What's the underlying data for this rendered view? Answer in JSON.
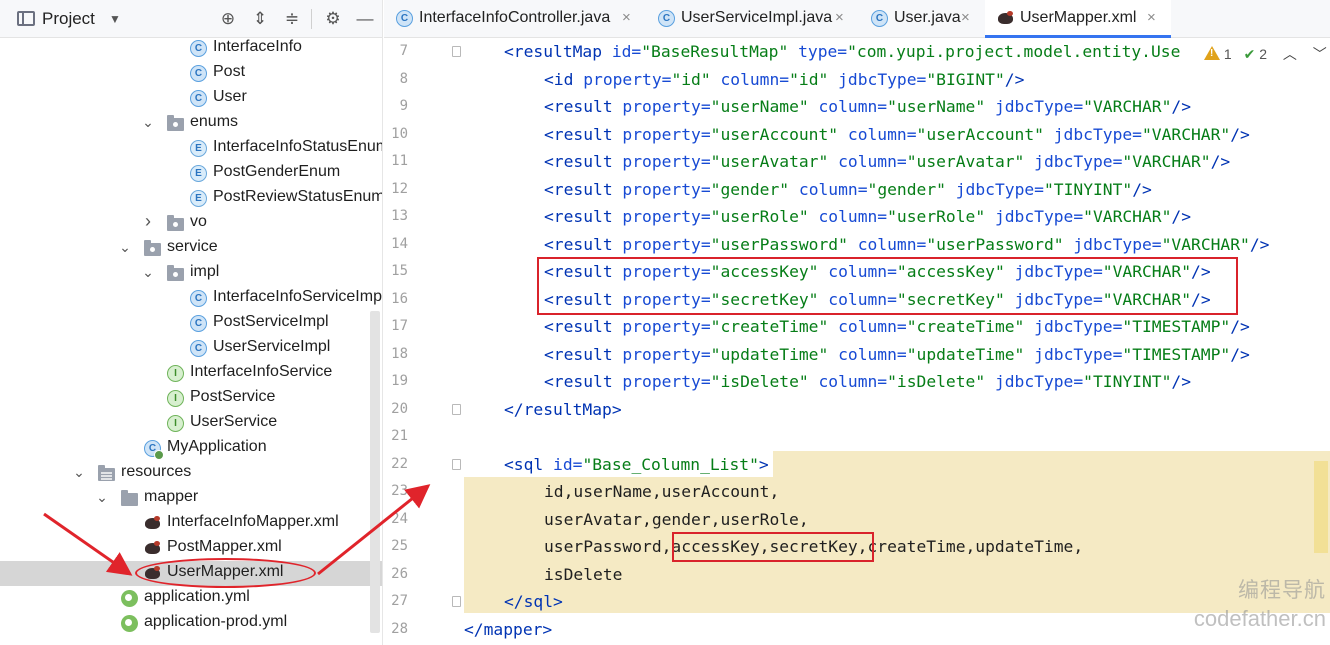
{
  "project_panel": {
    "title": "Project",
    "tools": [
      "target-icon",
      "expand-all-icon",
      "collapse-all-icon",
      "gear-icon",
      "minimize-icon"
    ],
    "tree": [
      {
        "label": "InterfaceInfo",
        "icon": "class",
        "depth": 5
      },
      {
        "label": "Post",
        "icon": "class",
        "depth": 5
      },
      {
        "label": "User",
        "icon": "class",
        "depth": 5
      },
      {
        "label": "enums",
        "icon": "package",
        "depth": 4,
        "expanded": true
      },
      {
        "label": "InterfaceInfoStatusEnum",
        "icon": "enum",
        "depth": 5
      },
      {
        "label": "PostGenderEnum",
        "icon": "enum",
        "depth": 5
      },
      {
        "label": "PostReviewStatusEnum",
        "icon": "enum",
        "depth": 5
      },
      {
        "label": "vo",
        "icon": "package",
        "depth": 4,
        "expanded": false
      },
      {
        "label": "service",
        "icon": "package",
        "depth": 3,
        "expanded": true
      },
      {
        "label": "impl",
        "icon": "package",
        "depth": 4,
        "expanded": true
      },
      {
        "label": "InterfaceInfoServiceImpl",
        "icon": "class",
        "depth": 5
      },
      {
        "label": "PostServiceImpl",
        "icon": "class",
        "depth": 5
      },
      {
        "label": "UserServiceImpl",
        "icon": "class",
        "depth": 5
      },
      {
        "label": "InterfaceInfoService",
        "icon": "interface",
        "depth": 4
      },
      {
        "label": "PostService",
        "icon": "interface",
        "depth": 4
      },
      {
        "label": "UserService",
        "icon": "interface",
        "depth": 4
      },
      {
        "label": "MyApplication",
        "icon": "app",
        "depth": 3
      },
      {
        "label": "resources",
        "icon": "resources",
        "depth": 1,
        "expanded": true
      },
      {
        "label": "mapper",
        "icon": "folder",
        "depth": 2,
        "expanded": true
      },
      {
        "label": "InterfaceInfoMapper.xml",
        "icon": "mybatis",
        "depth": 3
      },
      {
        "label": "PostMapper.xml",
        "icon": "mybatis",
        "depth": 3
      },
      {
        "label": "UserMapper.xml",
        "icon": "mybatis",
        "depth": 3,
        "selected": true
      },
      {
        "label": "application.yml",
        "icon": "yml",
        "depth": 2
      },
      {
        "label": "application-prod.yml",
        "icon": "yml",
        "depth": 2
      }
    ]
  },
  "tabs": [
    {
      "label": "InterfaceInfoController.java",
      "icon": "class",
      "active": false
    },
    {
      "label": "UserServiceImpl.java",
      "icon": "class",
      "active": false
    },
    {
      "label": "User.java",
      "icon": "class",
      "active": false
    },
    {
      "label": "UserMapper.xml",
      "icon": "mybatis",
      "active": true
    }
  ],
  "inspection": {
    "warnings": "1",
    "checks": "2"
  },
  "editor": {
    "lines": [
      {
        "n": "7",
        "tokens": [
          [
            "t",
            "<resultMap "
          ],
          [
            "a",
            "id="
          ],
          [
            "v",
            "\"BaseResultMap\" "
          ],
          [
            "a",
            "type="
          ],
          [
            "v",
            "\"com.yupi.project.model.entity.Use"
          ]
        ]
      },
      {
        "n": "8",
        "tokens": [
          [
            "t",
            "<id "
          ],
          [
            "a",
            "property="
          ],
          [
            "v",
            "\"id\" "
          ],
          [
            "a",
            "column="
          ],
          [
            "v",
            "\"id\" "
          ],
          [
            "a",
            "jdbcType="
          ],
          [
            "v",
            "\"BIGINT\""
          ],
          [
            "t",
            "/>"
          ]
        ]
      },
      {
        "n": "9",
        "tokens": [
          [
            "t",
            "<result "
          ],
          [
            "a",
            "property="
          ],
          [
            "v",
            "\"userName\" "
          ],
          [
            "a",
            "column="
          ],
          [
            "v",
            "\"userName\" "
          ],
          [
            "a",
            "jdbcType="
          ],
          [
            "v",
            "\"VARCHAR\""
          ],
          [
            "t",
            "/>"
          ]
        ]
      },
      {
        "n": "10",
        "tokens": [
          [
            "t",
            "<result "
          ],
          [
            "a",
            "property="
          ],
          [
            "v",
            "\"userAccount\" "
          ],
          [
            "a",
            "column="
          ],
          [
            "v",
            "\"userAccount\" "
          ],
          [
            "a",
            "jdbcType="
          ],
          [
            "v",
            "\"VARCHAR\""
          ],
          [
            "t",
            "/>"
          ]
        ]
      },
      {
        "n": "11",
        "tokens": [
          [
            "t",
            "<result "
          ],
          [
            "a",
            "property="
          ],
          [
            "v",
            "\"userAvatar\" "
          ],
          [
            "a",
            "column="
          ],
          [
            "v",
            "\"userAvatar\" "
          ],
          [
            "a",
            "jdbcType="
          ],
          [
            "v",
            "\"VARCHAR\""
          ],
          [
            "t",
            "/>"
          ]
        ]
      },
      {
        "n": "12",
        "tokens": [
          [
            "t",
            "<result "
          ],
          [
            "a",
            "property="
          ],
          [
            "v",
            "\"gender\" "
          ],
          [
            "a",
            "column="
          ],
          [
            "v",
            "\"gender\" "
          ],
          [
            "a",
            "jdbcType="
          ],
          [
            "v",
            "\"TINYINT\""
          ],
          [
            "t",
            "/>"
          ]
        ]
      },
      {
        "n": "13",
        "tokens": [
          [
            "t",
            "<result "
          ],
          [
            "a",
            "property="
          ],
          [
            "v",
            "\"userRole\" "
          ],
          [
            "a",
            "column="
          ],
          [
            "v",
            "\"userRole\" "
          ],
          [
            "a",
            "jdbcType="
          ],
          [
            "v",
            "\"VARCHAR\""
          ],
          [
            "t",
            "/>"
          ]
        ]
      },
      {
        "n": "14",
        "tokens": [
          [
            "t",
            "<result "
          ],
          [
            "a",
            "property="
          ],
          [
            "v",
            "\"userPassword\" "
          ],
          [
            "a",
            "column="
          ],
          [
            "v",
            "\"userPassword\" "
          ],
          [
            "a",
            "jdbcType="
          ],
          [
            "v",
            "\"VARCHAR\""
          ],
          [
            "t",
            "/>"
          ]
        ]
      },
      {
        "n": "15",
        "tokens": [
          [
            "t",
            "<result "
          ],
          [
            "a",
            "property="
          ],
          [
            "v",
            "\"accessKey\" "
          ],
          [
            "a",
            "column="
          ],
          [
            "v",
            "\"accessKey\" "
          ],
          [
            "a",
            "jdbcType="
          ],
          [
            "v",
            "\"VARCHAR\""
          ],
          [
            "t",
            "/>"
          ]
        ]
      },
      {
        "n": "16",
        "tokens": [
          [
            "t",
            "<result "
          ],
          [
            "a",
            "property="
          ],
          [
            "v",
            "\"secretKey\" "
          ],
          [
            "a",
            "column="
          ],
          [
            "v",
            "\"secretKey\" "
          ],
          [
            "a",
            "jdbcType="
          ],
          [
            "v",
            "\"VARCHAR\""
          ],
          [
            "t",
            "/>"
          ]
        ]
      },
      {
        "n": "17",
        "tokens": [
          [
            "t",
            "<result "
          ],
          [
            "a",
            "property="
          ],
          [
            "v",
            "\"createTime\" "
          ],
          [
            "a",
            "column="
          ],
          [
            "v",
            "\"createTime\" "
          ],
          [
            "a",
            "jdbcType="
          ],
          [
            "v",
            "\"TIMESTAMP\""
          ],
          [
            "t",
            "/>"
          ]
        ]
      },
      {
        "n": "18",
        "tokens": [
          [
            "t",
            "<result "
          ],
          [
            "a",
            "property="
          ],
          [
            "v",
            "\"updateTime\" "
          ],
          [
            "a",
            "column="
          ],
          [
            "v",
            "\"updateTime\" "
          ],
          [
            "a",
            "jdbcType="
          ],
          [
            "v",
            "\"TIMESTAMP\""
          ],
          [
            "t",
            "/>"
          ]
        ]
      },
      {
        "n": "19",
        "tokens": [
          [
            "t",
            "<result "
          ],
          [
            "a",
            "property="
          ],
          [
            "v",
            "\"isDelete\" "
          ],
          [
            "a",
            "column="
          ],
          [
            "v",
            "\"isDelete\" "
          ],
          [
            "a",
            "jdbcType="
          ],
          [
            "v",
            "\"TINYINT\""
          ],
          [
            "t",
            "/>"
          ]
        ]
      },
      {
        "n": "20",
        "tokens": [
          [
            "t",
            "</resultMap>"
          ]
        ]
      },
      {
        "n": "21",
        "tokens": []
      },
      {
        "n": "22",
        "tokens": [
          [
            "t",
            "<sql "
          ],
          [
            "a",
            "id="
          ],
          [
            "v",
            "\"Base_Column_List\""
          ],
          [
            "t",
            ">"
          ]
        ]
      },
      {
        "n": "23",
        "tokens": [
          [
            "x",
            "id,userName,userAccount,"
          ]
        ]
      },
      {
        "n": "24",
        "tokens": [
          [
            "x",
            "userAvatar,gender,userRole,"
          ]
        ]
      },
      {
        "n": "25",
        "tokens": [
          [
            "x",
            "userPassword,accessKey,secretKey,createTime,updateTime,"
          ]
        ]
      },
      {
        "n": "26",
        "tokens": [
          [
            "x",
            "isDelete"
          ]
        ]
      },
      {
        "n": "27",
        "tokens": [
          [
            "t",
            "</sql>"
          ]
        ]
      },
      {
        "n": "28",
        "tokens": [
          [
            "t",
            "</mapper>"
          ]
        ]
      }
    ]
  },
  "watermark": {
    "line1": "编程导航",
    "line2": "codefather.cn"
  },
  "colors": {
    "accent": "#3574f0",
    "annotation": "#d9232b",
    "highlight": "#f5eac4"
  }
}
